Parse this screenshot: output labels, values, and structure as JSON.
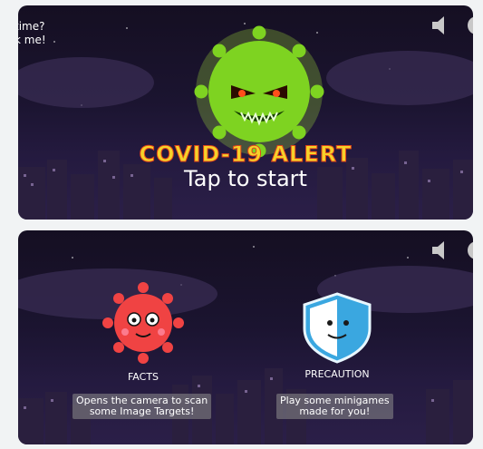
{
  "start_screen": {
    "hint_line1": "time?",
    "hint_line2": "k me!",
    "alert_title": "COVID-19 ALERT",
    "tap_text": "Tap to start",
    "icons": [
      "virus-monster-icon",
      "speaker-icon",
      "gear-icon"
    ]
  },
  "menu_screen": {
    "facts": {
      "label": "FACTS",
      "desc1": "Opens the camera to scan",
      "desc2": "some Image Targets!"
    },
    "precaution": {
      "label": "PRECAUTION",
      "desc1": "Play some minigames",
      "desc2": "made for you!"
    },
    "icons": [
      "virus-mascot-icon",
      "shield-icon",
      "speaker-icon",
      "gear-icon"
    ]
  },
  "colors": {
    "title_fill": "#f5d22a",
    "title_stroke": "#e0421c",
    "virus_green": "#7ed321",
    "virus_red": "#f04343",
    "shield_blue": "#3aa7e0"
  }
}
